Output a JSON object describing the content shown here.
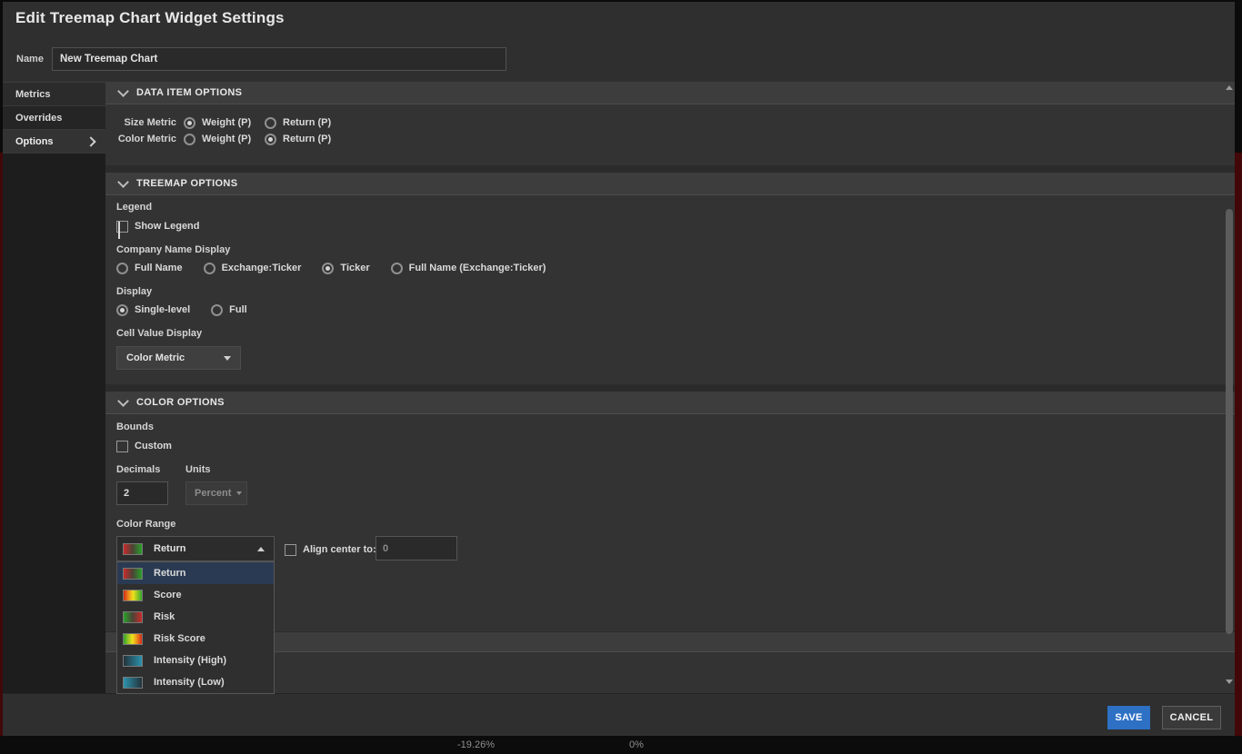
{
  "window": {
    "title": "Edit Treemap Chart Widget Settings"
  },
  "name_field": {
    "label": "Name",
    "value": "New Treemap Chart"
  },
  "sidebar": {
    "items": [
      {
        "label": "Metrics"
      },
      {
        "label": "Overrides"
      },
      {
        "label": "Options"
      }
    ],
    "selected": "Options"
  },
  "sections": {
    "data_item_options": {
      "title": "DATA ITEM OPTIONS",
      "size_metric": {
        "label": "Size Metric",
        "options": [
          {
            "label": "Weight (P)",
            "selected": true
          },
          {
            "label": "Return (P)",
            "selected": false
          }
        ]
      },
      "color_metric": {
        "label": "Color Metric",
        "options": [
          {
            "label": "Weight (P)",
            "selected": false
          },
          {
            "label": "Return (P)",
            "selected": true
          }
        ]
      }
    },
    "treemap_options": {
      "title": "TREEMAP OPTIONS",
      "legend": {
        "label": "Legend",
        "checkbox_label": "Show Legend",
        "checked": true
      },
      "company_name_display": {
        "label": "Company Name Display",
        "options": [
          {
            "label": "Full Name",
            "selected": false
          },
          {
            "label": "Exchange:Ticker",
            "selected": false
          },
          {
            "label": "Ticker",
            "selected": true
          },
          {
            "label": "Full Name (Exchange:Ticker)",
            "selected": false
          }
        ]
      },
      "display": {
        "label": "Display",
        "options": [
          {
            "label": "Single-level",
            "selected": true
          },
          {
            "label": "Full",
            "selected": false
          }
        ]
      },
      "cell_value_display": {
        "label": "Cell Value Display",
        "selected": "Color Metric"
      }
    },
    "color_options": {
      "title": "COLOR OPTIONS",
      "bounds": {
        "label": "Bounds",
        "checkbox_label": "Custom",
        "checked": false
      },
      "decimals": {
        "label": "Decimals",
        "value": "2"
      },
      "units": {
        "label": "Units",
        "value": "Percent",
        "disabled": true
      },
      "color_range": {
        "label": "Color Range",
        "selected": "Return",
        "open": true,
        "options": [
          {
            "label": "Return",
            "swatch": "return",
            "selected": true
          },
          {
            "label": "Score",
            "swatch": "score",
            "selected": false
          },
          {
            "label": "Risk",
            "swatch": "risk",
            "selected": false
          },
          {
            "label": "Risk Score",
            "swatch": "risk-score",
            "selected": false
          },
          {
            "label": "Intensity (High)",
            "swatch": "intensity-high",
            "selected": false
          },
          {
            "label": "Intensity (Low)",
            "swatch": "intensity-low",
            "selected": false
          }
        ]
      },
      "align_center": {
        "label": "Align center to:",
        "checked": false,
        "value": "0"
      }
    }
  },
  "footer": {
    "save": "SAVE",
    "cancel": "CANCEL"
  },
  "background_chart_legend": {
    "left_value": "-19.26%",
    "right_value": "0%"
  },
  "colors": {
    "accent_blue": "#2d70c4",
    "highlighted_option_bg": "#2a3a52",
    "background_treemap_red": "#420708",
    "swatch_gradients": {
      "return": [
        "#c92b2b",
        "#4a4336",
        "#2ba02b"
      ],
      "score": [
        "#d22c17",
        "#eee21c",
        "#35a62e"
      ],
      "risk": [
        "#2ba02b",
        "#4a4336",
        "#c92b2b"
      ],
      "risk_score": [
        "#35a62e",
        "#eee21c",
        "#d22c17"
      ],
      "intensity_high": [
        "#23333c",
        "#2d93ad"
      ],
      "intensity_low": [
        "#2d93ad",
        "#23333c"
      ]
    }
  }
}
